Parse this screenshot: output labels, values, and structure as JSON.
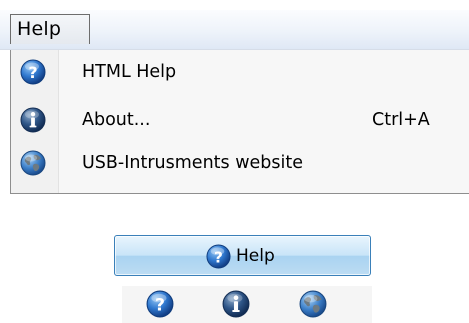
{
  "menubar": {
    "help_label": "Help"
  },
  "menu": {
    "items": [
      {
        "label": "HTML Help",
        "shortcut": "",
        "icon": "help-icon"
      },
      {
        "label": "About...",
        "shortcut": "Ctrl+A",
        "icon": "info-icon"
      },
      {
        "label": "USB-Intrusments website",
        "shortcut": "",
        "icon": "globe-icon"
      }
    ]
  },
  "toolbar": {
    "help_button_label": "Help",
    "icons": [
      "help-icon",
      "info-icon",
      "globe-icon"
    ]
  },
  "colors": {
    "icon_blue": "#2a6fc2",
    "button_border": "#3a80b9"
  }
}
